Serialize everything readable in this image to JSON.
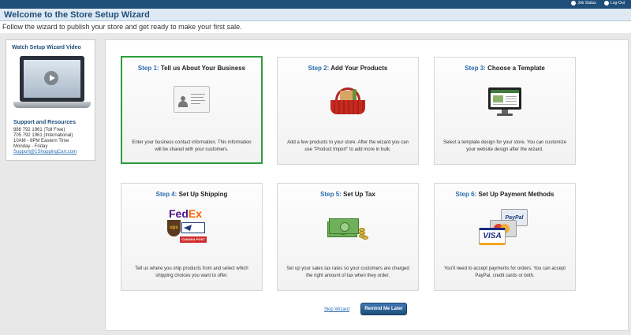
{
  "topbar": {
    "job_status": "Job Status",
    "logout": "Log-Out"
  },
  "header": {
    "title": "Welcome to the Store Setup Wizard",
    "subtitle": "Follow the wizard to publish your store and get ready to make your first sale."
  },
  "sidebar": {
    "video_title": "Watch Setup Wizard Video",
    "support_title": "Support and Resources",
    "phone_tollfree": "888 792 1961 (Toll Free)",
    "phone_international": "705 792 1961 (International)",
    "hours": "10AM - 8PM Eastern Time",
    "days": "Monday - Friday",
    "email": "Support@1ShoppingCart.com"
  },
  "steps": [
    {
      "step": "Step 1:",
      "title": "Tell us About Your Business",
      "desc": "Enter your business contact information. This information will be shared with your customers.",
      "icon": "contact-card-icon"
    },
    {
      "step": "Step 2:",
      "title": "Add Your Products",
      "desc": "Add a few products to your store. After the wizard you can use \"Product Import\" to add more in bulk.",
      "icon": "shopping-basket-icon"
    },
    {
      "step": "Step 3:",
      "title": "Choose a Template",
      "desc": "Select a template design for your store. You can customize your website design after the wizard.",
      "icon": "monitor-template-icon"
    },
    {
      "step": "Step 4:",
      "title": "Set Up Shipping",
      "desc": "Tell us where you ship products from and select which shipping choices you want to offer.",
      "icon": "shipping-carriers-icon"
    },
    {
      "step": "Step 5:",
      "title": "Set Up Tax",
      "desc": "Set up your sales tax rates so your customers are charged the right amount of tax when they order.",
      "icon": "money-icon"
    },
    {
      "step": "Step 6:",
      "title": "Set Up Payment Methods",
      "desc": "You'll need to accept payments for orders. You can accept PayPal, credit cards or both.",
      "icon": "credit-cards-icon"
    }
  ],
  "logos": {
    "fedex_fed": "Fed",
    "fedex_ex": "Ex",
    "ups": "ups",
    "canada_post": "CANADA POST",
    "paypal": "PayPal",
    "visa": "VISA"
  },
  "actions": {
    "skip": "Skip Wizard",
    "remind": "Remind Me Later"
  },
  "colors": {
    "brand": "#1f4e79",
    "step_accent": "#2b6cb0",
    "active_border": "#2e9c3f"
  }
}
